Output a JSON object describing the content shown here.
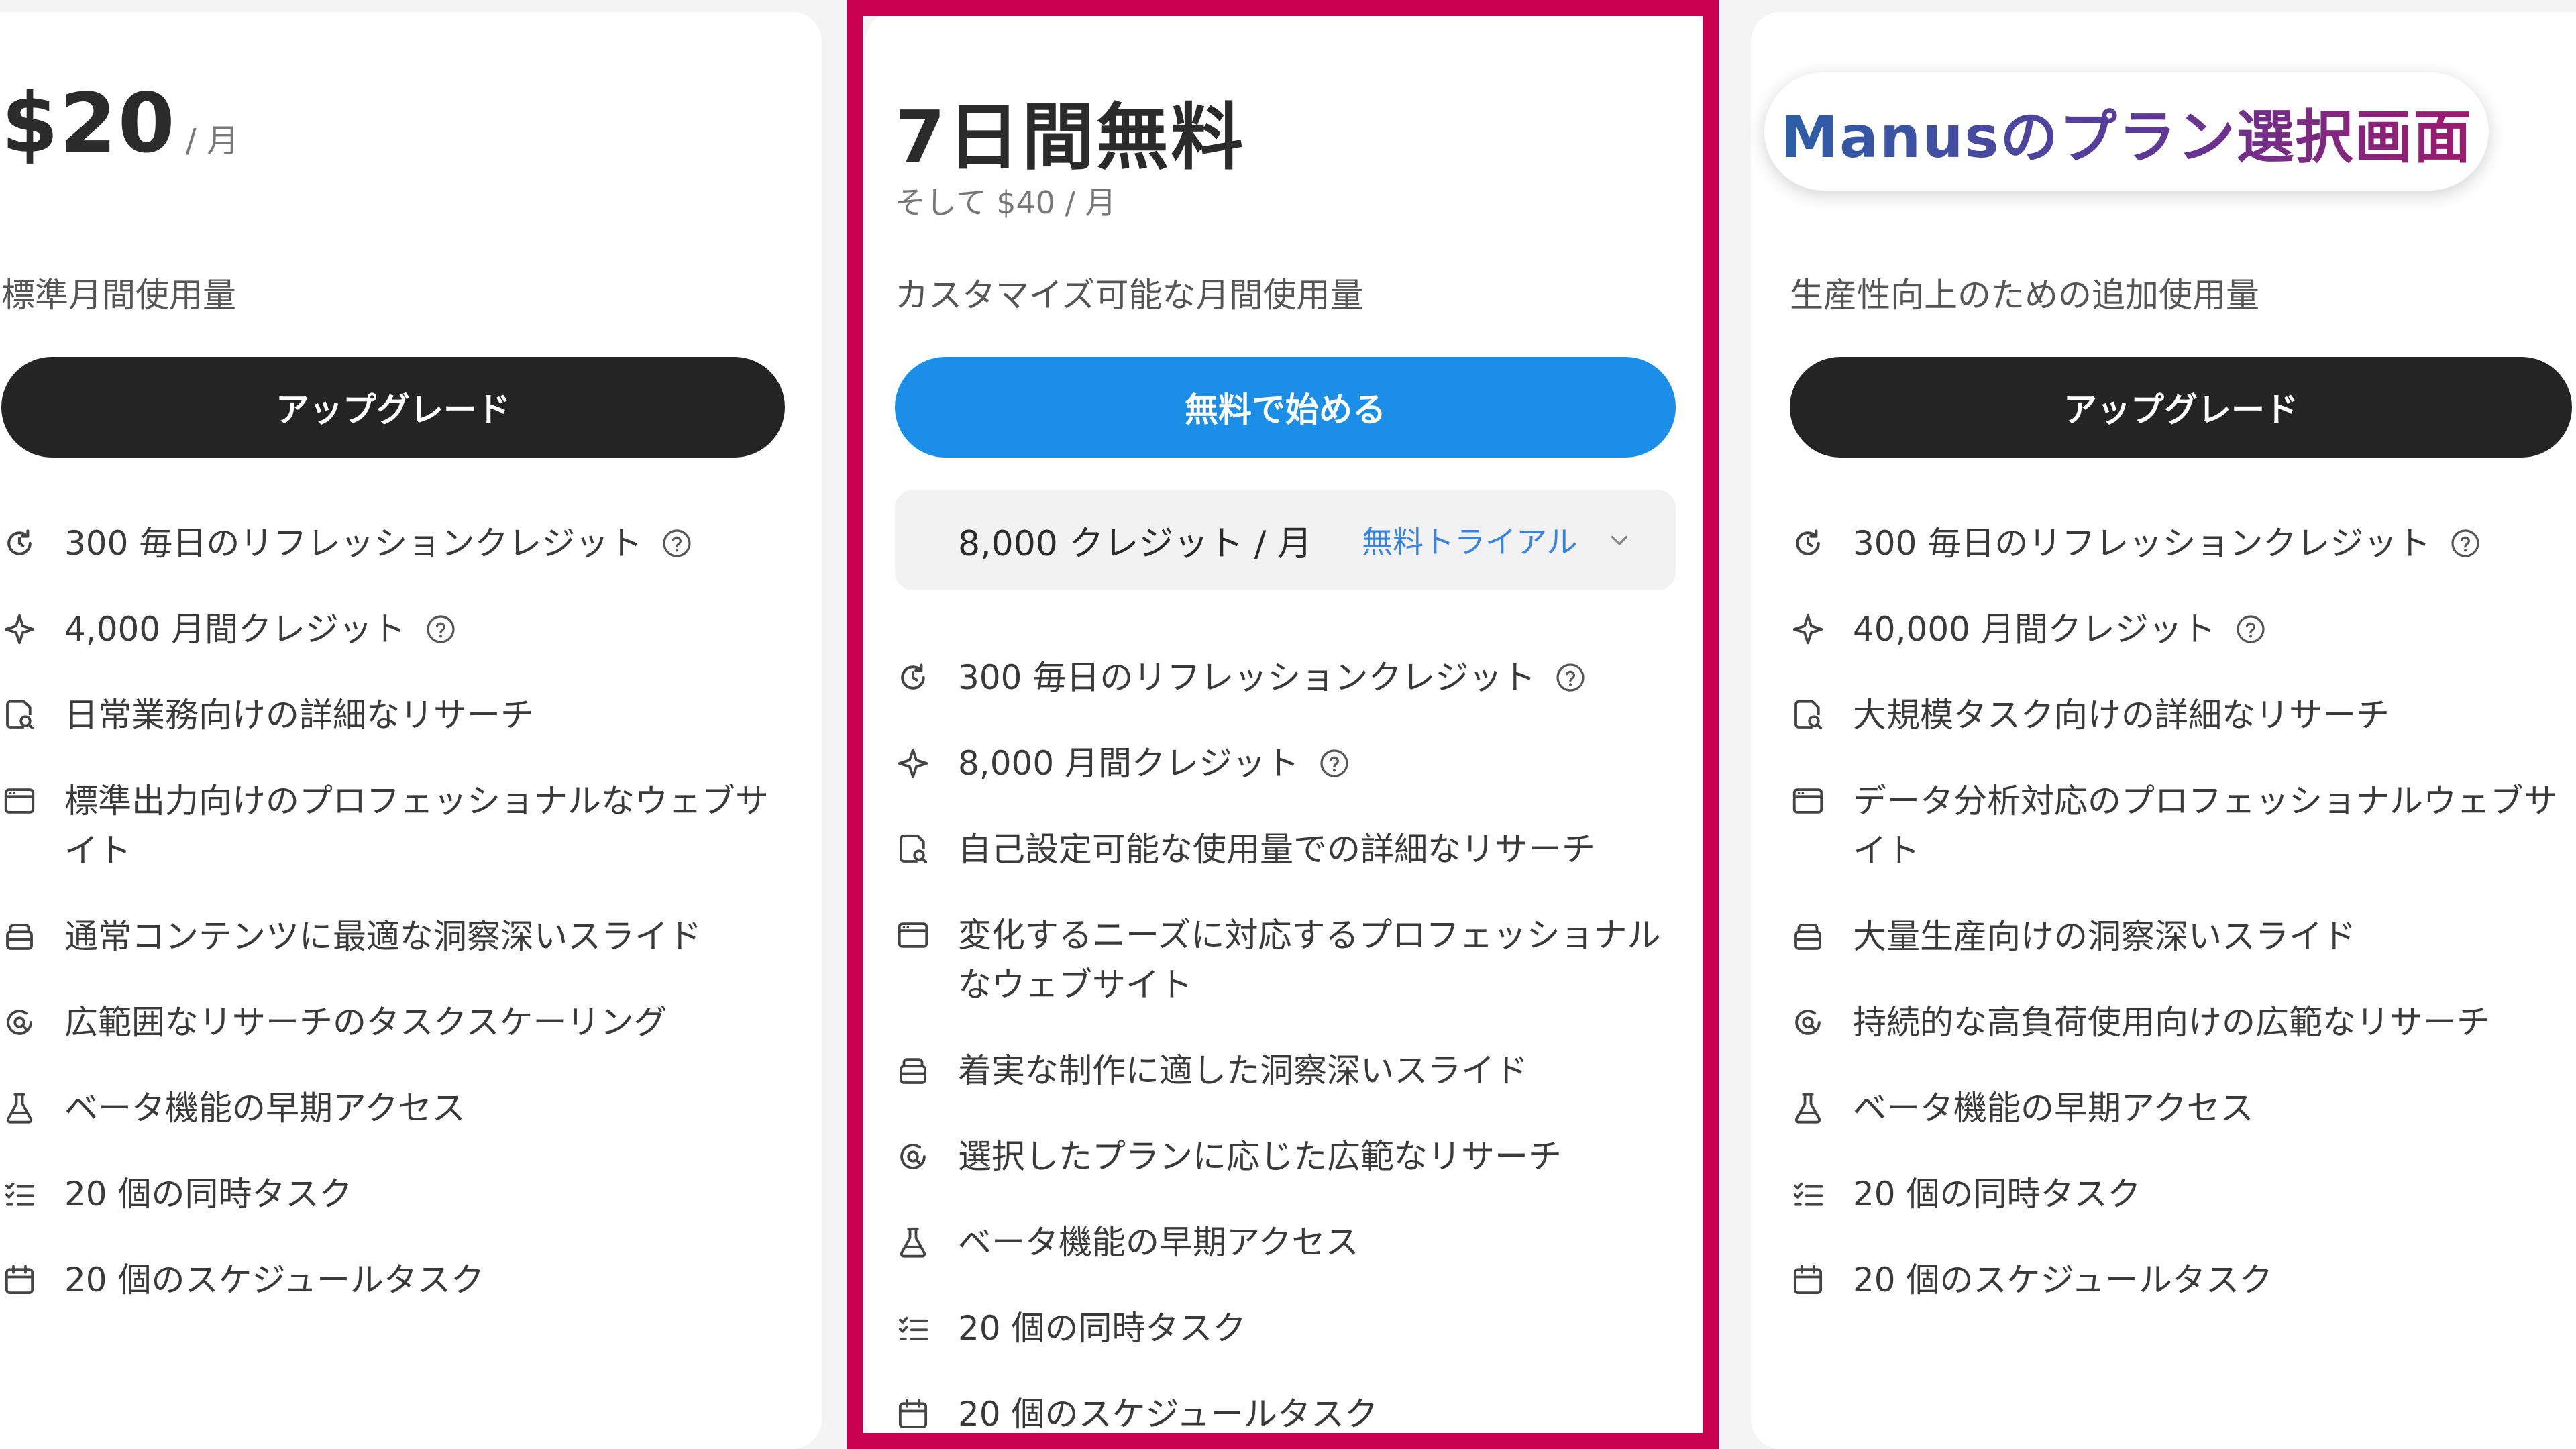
{
  "colors": {
    "highlight_border": "#c8004f",
    "primary_button": "#1b8ee8",
    "dark_button": "#242424",
    "trial_link": "#3a84e0"
  },
  "overlay": {
    "label": "Manusのプラン選択画面"
  },
  "plans": [
    {
      "price": "$20",
      "period": "/ 月",
      "subtitle": "標準月間使用量",
      "button_label": "アップグレード",
      "features": [
        {
          "icon": "refresh-clock-icon",
          "text": "300 毎日のリフレッションクレジット",
          "help": true
        },
        {
          "icon": "sparkle-icon",
          "text": "4,000 月間クレジット",
          "help": true
        },
        {
          "icon": "research-doc-icon",
          "text": "日常業務向けの詳細なリサーチ"
        },
        {
          "icon": "browser-window-icon",
          "text": "標準出力向けのプロフェッショナルなウェブサイト"
        },
        {
          "icon": "slides-icon",
          "text": "通常コンテンツに最適な洞察深いスライド"
        },
        {
          "icon": "wide-research-icon",
          "text": "広範囲なリサーチのタスクスケーリング"
        },
        {
          "icon": "beaker-icon",
          "text": "ベータ機能の早期アクセス"
        },
        {
          "icon": "task-list-icon",
          "text": "20 個の同時タスク"
        },
        {
          "icon": "calendar-icon",
          "text": "20 個のスケジュールタスク"
        }
      ]
    },
    {
      "headline": "7日間無料",
      "then_price": "そして $40 / 月",
      "subtitle": "カスタマイズ可能な月間使用量",
      "button_label": "無料で始める",
      "credits_value": "8,000 クレジット / 月",
      "credits_trial": "無料トライアル",
      "features": [
        {
          "icon": "refresh-clock-icon",
          "text": "300 毎日のリフレッションクレジット",
          "help": true
        },
        {
          "icon": "sparkle-icon",
          "text": "8,000 月間クレジット",
          "help": true
        },
        {
          "icon": "research-doc-icon",
          "text": "自己設定可能な使用量での詳細なリサーチ"
        },
        {
          "icon": "browser-window-icon",
          "text": "変化するニーズに対応するプロフェッショナルなウェブサイト"
        },
        {
          "icon": "slides-icon",
          "text": "着実な制作に適した洞察深いスライド"
        },
        {
          "icon": "wide-research-icon",
          "text": "選択したプランに応じた広範なリサーチ"
        },
        {
          "icon": "beaker-icon",
          "text": "ベータ機能の早期アクセス"
        },
        {
          "icon": "task-list-icon",
          "text": "20 個の同時タスク"
        },
        {
          "icon": "calendar-icon",
          "text": "20 個のスケジュールタスク"
        }
      ]
    },
    {
      "subtitle": "生産性向上のための追加使用量",
      "button_label": "アップグレード",
      "features": [
        {
          "icon": "refresh-clock-icon",
          "text": "300 毎日のリフレッションクレジット",
          "help": true
        },
        {
          "icon": "sparkle-icon",
          "text": "40,000 月間クレジット",
          "help": true
        },
        {
          "icon": "research-doc-icon",
          "text": "大規模タスク向けの詳細なリサーチ"
        },
        {
          "icon": "browser-window-icon",
          "text": "データ分析対応のプロフェッショナルウェブサイト"
        },
        {
          "icon": "slides-icon",
          "text": "大量生産向けの洞察深いスライド"
        },
        {
          "icon": "wide-research-icon",
          "text": "持続的な高負荷使用向けの広範なリサーチ"
        },
        {
          "icon": "beaker-icon",
          "text": "ベータ機能の早期アクセス"
        },
        {
          "icon": "task-list-icon",
          "text": "20 個の同時タスク"
        },
        {
          "icon": "calendar-icon",
          "text": "20 個のスケジュールタスク"
        }
      ]
    }
  ]
}
